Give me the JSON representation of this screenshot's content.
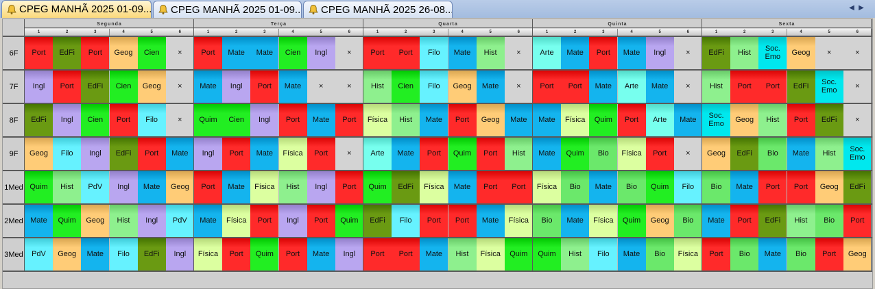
{
  "tabs": [
    {
      "title": "CPEG MANHÃ 2025 01-09...",
      "active": true
    },
    {
      "title": "CPEG MANHÃ 2025 01-09...",
      "active": false
    },
    {
      "title": "CPEG MANHÃ 2025 26-08...",
      "active": false
    }
  ],
  "nav": {
    "prev": "◀",
    "next": "▶"
  },
  "days": [
    "Segunda",
    "Terça",
    "Quarta",
    "Quinta",
    "Sexta"
  ],
  "periods": [
    "1",
    "2",
    "3",
    "4",
    "5",
    "6"
  ],
  "empty_mark": "×",
  "subject_colors": {
    "Port": "#ff2a2a",
    "EdFi": "#6a9a12",
    "Geog": "#ffcc77",
    "Cien": "#22ee22",
    "Mate": "#14b4ee",
    "Ingl": "#b9a6f0",
    "Filo": "#66f2ff",
    "Hist": "#8ef08e",
    "Arte": "#77ffee",
    "Soc. Emo": "#00e8ee",
    "Quim": "#22ee22",
    "Física": "#dcffa0",
    "PdV": "#66f2ff",
    "Bio": "#6be86b"
  },
  "rows": [
    {
      "label": "6F",
      "cells": [
        [
          "Port",
          "EdFi",
          "Port",
          "Geog",
          "Cien",
          ""
        ],
        [
          "Port",
          "Mate",
          "Mate",
          "Cien",
          "Ingl",
          ""
        ],
        [
          "Port",
          "Port",
          "Filo",
          "Mate",
          "Hist",
          ""
        ],
        [
          "Arte",
          "Mate",
          "Port",
          "Mate",
          "Ingl",
          ""
        ],
        [
          "EdFi",
          "Hist",
          "Soc. Emo",
          "Geog",
          "",
          ""
        ]
      ]
    },
    {
      "label": "7F",
      "cells": [
        [
          "Ingl",
          "Port",
          "EdFi",
          "Cien",
          "Geog",
          ""
        ],
        [
          "Mate",
          "Ingl",
          "Port",
          "Mate",
          "",
          ""
        ],
        [
          "Hist",
          "Cien",
          "Filo",
          "Geog",
          "Mate",
          ""
        ],
        [
          "Port",
          "Port",
          "Mate",
          "Arte",
          "Mate",
          ""
        ],
        [
          "Hist",
          "Port",
          "Port",
          "EdFi",
          "Soc. Emo",
          ""
        ]
      ]
    },
    {
      "label": "8F",
      "cells": [
        [
          "EdFi",
          "Ingl",
          "Cien",
          "Port",
          "Filo",
          ""
        ],
        [
          "Quim",
          "Cien",
          "Ingl",
          "Port",
          "Mate",
          "Port"
        ],
        [
          "Física",
          "Hist",
          "Mate",
          "Port",
          "Geog",
          "Mate"
        ],
        [
          "Mate",
          "Física",
          "Quim",
          "Port",
          "Arte",
          "Mate"
        ],
        [
          "Soc. Emo",
          "Geog",
          "Hist",
          "Port",
          "EdFi",
          ""
        ]
      ]
    },
    {
      "label": "9F",
      "cells": [
        [
          "Geog",
          "Filo",
          "Ingl",
          "EdFi",
          "Port",
          "Mate"
        ],
        [
          "Ingl",
          "Port",
          "Mate",
          "Física",
          "Port",
          ""
        ],
        [
          "Arte",
          "Mate",
          "Port",
          "Quim",
          "Port",
          "Hist"
        ],
        [
          "Mate",
          "Quim",
          "Bio",
          "Física",
          "Port",
          ""
        ],
        [
          "Geog",
          "EdFi",
          "Bio",
          "Mate",
          "Hist",
          "Soc. Emo"
        ]
      ]
    },
    {
      "label": "1Med",
      "cells": [
        [
          "Quim",
          "Hist",
          "PdV",
          "Ingl",
          "Mate",
          "Geog"
        ],
        [
          "Port",
          "Mate",
          "Física",
          "Hist",
          "Ingl",
          "Port"
        ],
        [
          "Quim",
          "EdFi",
          "Física",
          "Mate",
          "Port",
          "Port"
        ],
        [
          "Física",
          "Bio",
          "Mate",
          "Bio",
          "Quim",
          "Filo"
        ],
        [
          "Bio",
          "Mate",
          "Port",
          "Port",
          "Geog",
          "EdFi"
        ]
      ]
    },
    {
      "label": "2Med",
      "cells": [
        [
          "Mate",
          "Quim",
          "Geog",
          "Hist",
          "Ingl",
          "PdV"
        ],
        [
          "Mate",
          "Física",
          "Port",
          "Ingl",
          "Port",
          "Quim"
        ],
        [
          "EdFi",
          "Filo",
          "Port",
          "Port",
          "Mate",
          "Física"
        ],
        [
          "Bio",
          "Mate",
          "Física",
          "Quim",
          "Geog",
          "Bio"
        ],
        [
          "Mate",
          "Port",
          "EdFi",
          "Hist",
          "Bio",
          "Port"
        ]
      ]
    },
    {
      "label": "3Med",
      "cells": [
        [
          "PdV",
          "Geog",
          "Mate",
          "Filo",
          "EdFi",
          "Ingl"
        ],
        [
          "Física",
          "Port",
          "Quim",
          "Port",
          "Mate",
          "Ingl"
        ],
        [
          "Port",
          "Port",
          "Mate",
          "Hist",
          "Física",
          "Quim"
        ],
        [
          "Quim",
          "Hist",
          "Filo",
          "Mate",
          "Bio",
          "Física"
        ],
        [
          "Port",
          "Bio",
          "Mate",
          "Bio",
          "Port",
          "Geog"
        ]
      ]
    }
  ]
}
